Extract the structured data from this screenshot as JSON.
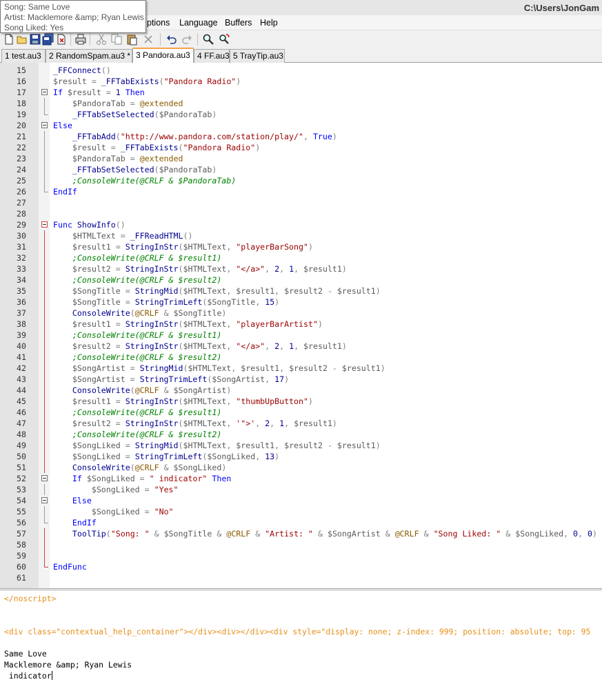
{
  "window": {
    "title": "C:\\Users\\JonGam"
  },
  "tooltip": {
    "lines": [
      "Song: Same Love",
      "Artist: Macklemore &amp; Ryan Lewis",
      "Song Liked: Yes"
    ]
  },
  "menu": {
    "items": [
      "ptions",
      "Language",
      "Buffers",
      "Help"
    ]
  },
  "toolbar": {
    "icons": [
      "new-file-icon",
      "open-file-icon",
      "save-icon",
      "close-icon",
      "print-icon",
      "cut-icon",
      "copy-icon",
      "paste-icon",
      "delete-icon",
      "undo-icon",
      "redo-icon",
      "find-icon",
      "replace-icon"
    ]
  },
  "tabs": [
    {
      "label": "1 test.au3"
    },
    {
      "label": "2 RandomSpam.au3 *"
    },
    {
      "label": "3 Pandora.au3",
      "active": true
    },
    {
      "label": "4 FF.au3"
    },
    {
      "label": "5 TrayTip.au3"
    }
  ],
  "editor": {
    "lines": [
      {
        "n": "15",
        "t": "_FFConnect()"
      },
      {
        "n": "16",
        "t": "$result = _FFTabExists(\"Pandora Radio\")"
      },
      {
        "n": "17",
        "t": "If $result = 1 Then"
      },
      {
        "n": "18",
        "t": "    $PandoraTab = @extended"
      },
      {
        "n": "19",
        "t": "    _FFTabSetSelected($PandoraTab)"
      },
      {
        "n": "20",
        "t": "Else"
      },
      {
        "n": "21",
        "t": "    _FFTabAdd(\"http://www.pandora.com/station/play/\", True)"
      },
      {
        "n": "22",
        "t": "    $result = _FFTabExists(\"Pandora Radio\")"
      },
      {
        "n": "23",
        "t": "    $PandoraTab = @extended"
      },
      {
        "n": "24",
        "t": "    _FFTabSetSelected($PandoraTab)"
      },
      {
        "n": "25",
        "t": "    ;ConsoleWrite(@CRLF & $PandoraTab)"
      },
      {
        "n": "26",
        "t": "EndIf"
      },
      {
        "n": "27",
        "t": ""
      },
      {
        "n": "28",
        "t": ""
      },
      {
        "n": "29",
        "t": "Func ShowInfo()"
      },
      {
        "n": "30",
        "t": "    $HTMLText = _FFReadHTML()"
      },
      {
        "n": "31",
        "t": "    $result1 = StringInStr($HTMLText, \"playerBarSong\")"
      },
      {
        "n": "32",
        "t": "    ;ConsoleWrite(@CRLF & $result1)"
      },
      {
        "n": "33",
        "t": "    $result2 = StringInStr($HTMLText, \"</a>\", 2, 1, $result1)"
      },
      {
        "n": "34",
        "t": "    ;ConsoleWrite(@CRLF & $result2)"
      },
      {
        "n": "35",
        "t": "    $SongTitle = StringMid($HTMLText, $result1, $result2 - $result1)"
      },
      {
        "n": "36",
        "t": "    $SongTitle = StringTrimLeft($SongTitle, 15)"
      },
      {
        "n": "37",
        "t": "    ConsoleWrite(@CRLF & $SongTitle)"
      },
      {
        "n": "38",
        "t": "    $result1 = StringInStr($HTMLText, \"playerBarArtist\")"
      },
      {
        "n": "39",
        "t": "    ;ConsoleWrite(@CRLF & $result1)"
      },
      {
        "n": "40",
        "t": "    $result2 = StringInStr($HTMLText, \"</a>\", 2, 1, $result1)"
      },
      {
        "n": "41",
        "t": "    ;ConsoleWrite(@CRLF & $result2)"
      },
      {
        "n": "42",
        "t": "    $SongArtist = StringMid($HTMLText, $result1, $result2 - $result1)"
      },
      {
        "n": "43",
        "t": "    $SongArtist = StringTrimLeft($SongArtist, 17)"
      },
      {
        "n": "44",
        "t": "    ConsoleWrite(@CRLF & $SongArtist)"
      },
      {
        "n": "45",
        "t": "    $result1 = StringInStr($HTMLText, \"thumbUpButton\")"
      },
      {
        "n": "46",
        "t": "    ;ConsoleWrite(@CRLF & $result1)"
      },
      {
        "n": "47",
        "t": "    $result2 = StringInStr($HTMLText, '\">', 2, 1, $result1)"
      },
      {
        "n": "48",
        "t": "    ;ConsoleWrite(@CRLF & $result2)"
      },
      {
        "n": "49",
        "t": "    $SongLiked = StringMid($HTMLText, $result1, $result2 - $result1)"
      },
      {
        "n": "50",
        "t": "    $SongLiked = StringTrimLeft($SongLiked, 13)"
      },
      {
        "n": "51",
        "t": "    ConsoleWrite(@CRLF & $SongLiked)"
      },
      {
        "n": "52",
        "t": "    If $SongLiked = \" indicator\" Then"
      },
      {
        "n": "53",
        "t": "        $SongLiked = \"Yes\""
      },
      {
        "n": "54",
        "t": "    Else"
      },
      {
        "n": "55",
        "t": "        $SongLiked = \"No\""
      },
      {
        "n": "56",
        "t": "    EndIf"
      },
      {
        "n": "57",
        "t": "    ToolTip(\"Song: \" & $SongTitle & @CRLF & \"Artist: \" & $SongArtist & @CRLF & \"Song Liked: \" & $SongLiked, 0, 0)"
      },
      {
        "n": "58",
        "t": ""
      },
      {
        "n": "59",
        "t": ""
      },
      {
        "n": "60",
        "t": "EndFunc"
      },
      {
        "n": "61",
        "t": ""
      }
    ]
  },
  "output": {
    "line1": "</noscript>",
    "line2": "<div class=\"contextual_help_container\"></div><div></div><div style=\"display: none; z-index: 999; position: absolute; top: 95",
    "line3": "Same Love",
    "line4": "Macklemore &amp; Ryan Lewis",
    "line5": " indicator"
  }
}
